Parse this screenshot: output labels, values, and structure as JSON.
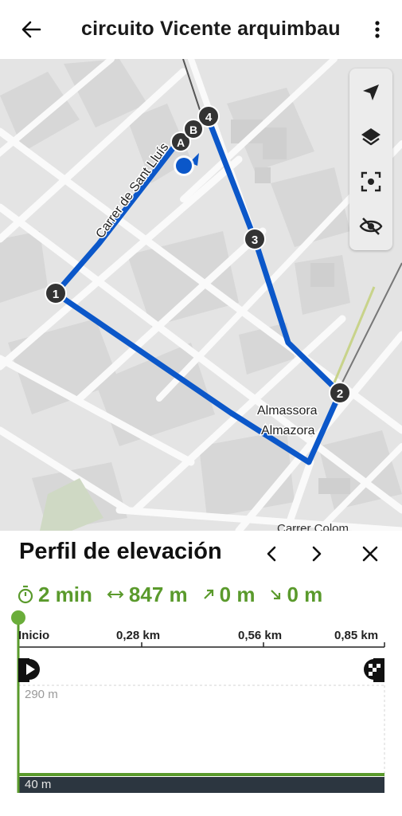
{
  "header": {
    "title": "circuito Vicente arquimbau"
  },
  "map": {
    "street_labels": [
      "Carrer de Sant Lluís",
      "Almassora",
      "Almazora",
      "Carrer Colom"
    ],
    "waypoints": [
      "1",
      "2",
      "3",
      "4",
      "A",
      "B"
    ],
    "route_color": "#0b57c9",
    "tools": [
      "navigate-icon",
      "layers-icon",
      "focus-icon",
      "hide-icon"
    ]
  },
  "panel": {
    "title": "Perfil de elevación",
    "stats": {
      "time": "2 min",
      "distance": "847 m",
      "ascent": "0 m",
      "descent": "0 m"
    },
    "x_ticks": [
      "Inicio",
      "0,28 km",
      "0,56 km",
      "0,85 km"
    ],
    "y_ticks": [
      "290 m",
      "40 m"
    ],
    "accent_color": "#5a9a2c"
  }
}
